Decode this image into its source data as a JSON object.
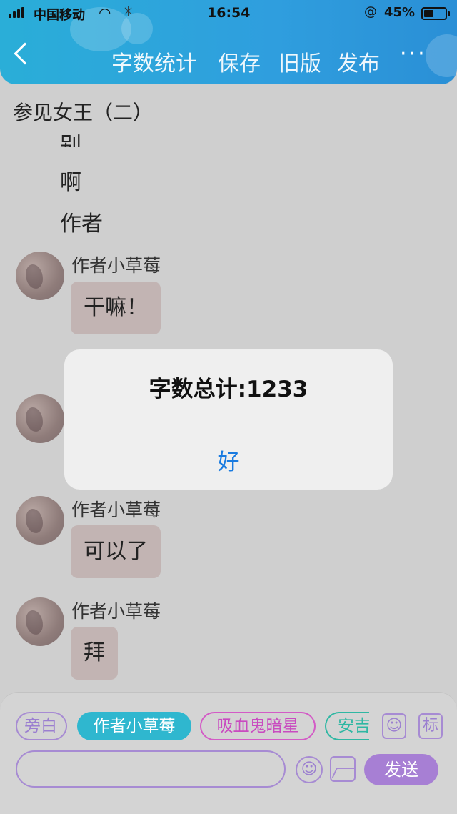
{
  "status_bar": {
    "carrier": "中国移动",
    "wifi_icon": "wifi-icon",
    "time": "16:54",
    "orientation_lock_icon": "@",
    "battery_percent": "45%",
    "battery_level": 0.45
  },
  "header": {
    "back_icon": "chevron-left-icon",
    "word_count": "字数统计",
    "save": "保存",
    "old_version": "旧版",
    "publish": "发布",
    "more": "···"
  },
  "document": {
    "title": "参见女王（二）"
  },
  "plain_lines": [
    "别",
    "啊",
    "作者"
  ],
  "messages": [
    {
      "name": "作者小草莓",
      "text": "干嘛！"
    },
    {
      "name": "作者小草莓",
      "text": "可以了"
    },
    {
      "name": "作者小草莓",
      "text": "拜"
    }
  ],
  "dialog": {
    "title": "字数总计:1233",
    "ok": "好"
  },
  "roles": {
    "narration": "旁白",
    "author": "作者小草莓",
    "vampire": "吸血鬼暗星",
    "partial": "安吉"
  },
  "toolbar": {
    "avatar_icon": "user-card-icon",
    "tag_label": "标",
    "send": "发送"
  },
  "colors": {
    "header_blue": "#2a9fdc",
    "accent_purple": "#a77fd4",
    "author_chip": "#2fb7cf",
    "vampire_chip": "#d35bc6",
    "dialog_button": "#1a7be0"
  }
}
